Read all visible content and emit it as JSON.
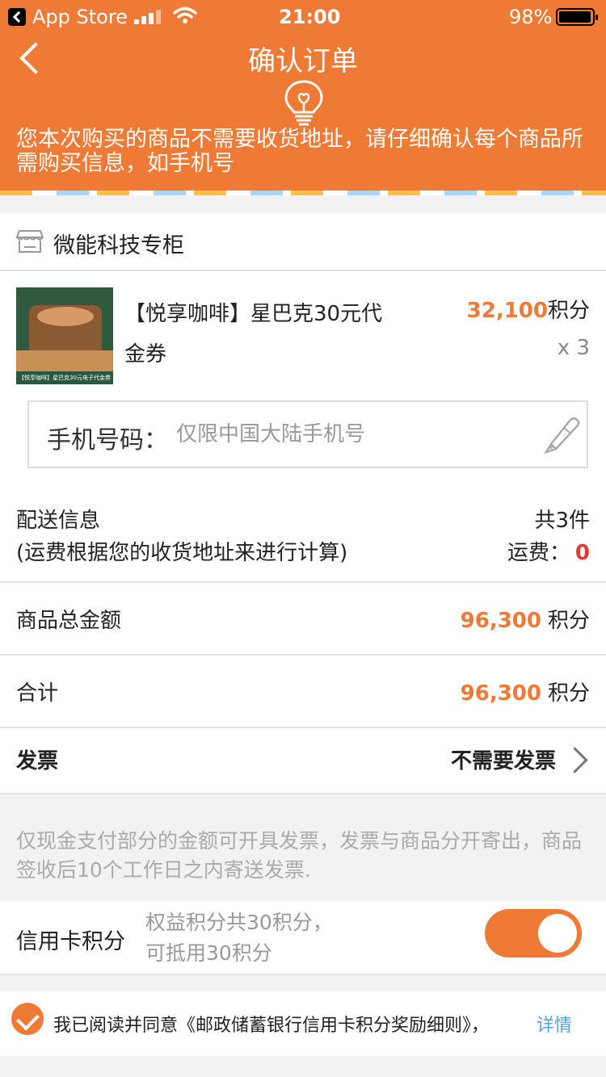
{
  "status_bar": {
    "back_app": "App Store",
    "time": "21:00",
    "battery": "98%",
    "battery_level": 0.98
  },
  "header": {
    "title": "确认订单",
    "notice": "您本次购买的商品不需要收货地址，请仔细确认每个商品所需购买信息，如手机号"
  },
  "shop": {
    "name": "微能科技专柜"
  },
  "product": {
    "name": "【悦享咖啡】星巴克30元代金券",
    "thumbnail_caption": "【悦享咖啡】星巴克30元电子代金券",
    "price_value": "32,100",
    "price_unit": "积分",
    "quantity": "x 3"
  },
  "phone": {
    "label": "手机号码：",
    "placeholder": "仅限中国大陆手机号"
  },
  "shipping": {
    "title": "配送信息",
    "note": "(运费根据您的收货地址来进行计算)",
    "count": "共3件",
    "fee_label": "运费：",
    "fee_value": "0"
  },
  "total_goods": {
    "label": "商品总金额",
    "value": "96,300",
    "unit": "积分"
  },
  "total": {
    "label": "合计",
    "value": "96,300",
    "unit": "积分"
  },
  "invoice": {
    "label": "发票",
    "value": "不需要发票",
    "note": "仅现金支付部分的金额可开具发票，发票与商品分开寄出，商品签收后10个工作日之内寄送发票."
  },
  "credit": {
    "label": "信用卡积分",
    "desc_line1": "权益积分共30积分，",
    "desc_line2": "可抵用30积分",
    "enabled": true
  },
  "agreement": {
    "text": "我已阅读并同意《邮政储蓄银行信用卡积分奖励细则》，",
    "link": "详情",
    "checked": true
  },
  "colors": {
    "accent": "#ee7a36",
    "link": "#5aa0e6",
    "zero_fee": "#e53935"
  }
}
